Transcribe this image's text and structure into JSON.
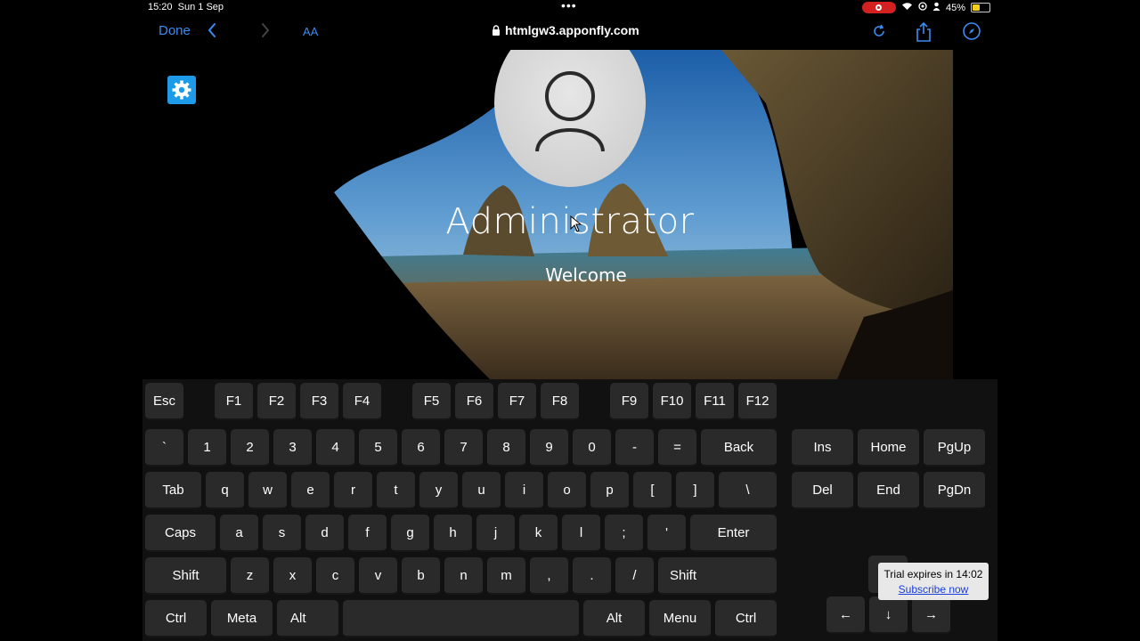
{
  "status_bar": {
    "time": "15:20",
    "date": "Sun 1 Sep",
    "battery": "45%"
  },
  "browser": {
    "done_label": "Done",
    "text_size_label": "AA",
    "url": "htmlgw3.apponfly.com"
  },
  "login": {
    "username": "Administrator",
    "status": "Welcome"
  },
  "keyboard": {
    "fn_row": [
      "Esc",
      "F1",
      "F2",
      "F3",
      "F4",
      "F5",
      "F6",
      "F7",
      "F8",
      "F9",
      "F10",
      "F11",
      "F12"
    ],
    "row1": [
      "`",
      "1",
      "2",
      "3",
      "4",
      "5",
      "6",
      "7",
      "8",
      "9",
      "0",
      "-",
      "=",
      "Back"
    ],
    "row2": [
      "Tab",
      "q",
      "w",
      "e",
      "r",
      "t",
      "y",
      "u",
      "i",
      "o",
      "p",
      "[",
      "]",
      "\\"
    ],
    "row3": [
      "Caps",
      "a",
      "s",
      "d",
      "f",
      "g",
      "h",
      "j",
      "k",
      "l",
      ";",
      "'",
      "Enter"
    ],
    "row4": [
      "Shift",
      "z",
      "x",
      "c",
      "v",
      "b",
      "n",
      "m",
      ",",
      ".",
      "/",
      "Shift"
    ],
    "row5": [
      "Ctrl",
      "Meta",
      "Alt",
      "",
      "Alt",
      "Menu",
      "Ctrl"
    ],
    "nav_block": [
      "Ins",
      "Home",
      "PgUp",
      "Del",
      "End",
      "PgDn"
    ],
    "arrows": [
      "←",
      "↓",
      "→"
    ]
  },
  "trial_notice": {
    "text": "Trial expires in 14:02",
    "link": "Subscribe now"
  }
}
